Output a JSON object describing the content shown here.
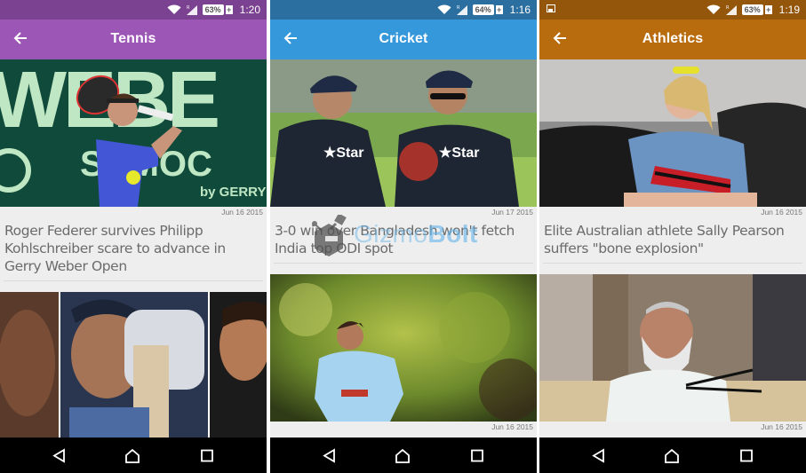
{
  "screens": [
    {
      "status": {
        "battery": "63%",
        "time": "1:20",
        "notification_icon": null
      },
      "appbar": {
        "title": "Tennis",
        "back_icon": "arrow-left-icon",
        "color": "#9c56b6",
        "status_color": "#7b4291"
      },
      "articles": [
        {
          "date": "Jun 16 2015",
          "headline": "Roger Federer survives Philipp Kohlschreiber scare to advance in Gerry Weber Open",
          "image": "tennis-player-photo"
        },
        {
          "date": "",
          "headline": "",
          "image": "cricket-collage-photo"
        }
      ]
    },
    {
      "status": {
        "battery": "64%",
        "time": "1:16",
        "notification_icon": null
      },
      "appbar": {
        "title": "Cricket",
        "back_icon": "arrow-left-icon",
        "color": "#3498db",
        "status_color": "#2a6fa0"
      },
      "articles": [
        {
          "date": "Jun 17 2015",
          "headline": "3-0 win over Bangladesh won't fetch India top ODI spot",
          "image": "cricket-players-photo"
        },
        {
          "date": "Jun 16 2015",
          "headline": "",
          "image": "cricket-bowler-photo"
        }
      ]
    },
    {
      "status": {
        "battery": "63%",
        "time": "1:19",
        "notification_icon": "gallery-icon"
      },
      "appbar": {
        "title": "Athletics",
        "back_icon": "arrow-left-icon",
        "color": "#b96c0e",
        "status_color": "#93560a"
      },
      "articles": [
        {
          "date": "Jun 16 2015",
          "headline": "Elite Australian athlete Sally Pearson suffers \"bone explosion\"",
          "image": "athlete-photo"
        },
        {
          "date": "Jun 16 2015",
          "headline": "",
          "image": "press-conference-photo"
        }
      ]
    }
  ],
  "navbar": {
    "back": "back-icon",
    "home": "home-icon",
    "recents": "recents-icon"
  },
  "watermark": {
    "prefix": "Gizmo",
    "suffix": "Bolt"
  }
}
